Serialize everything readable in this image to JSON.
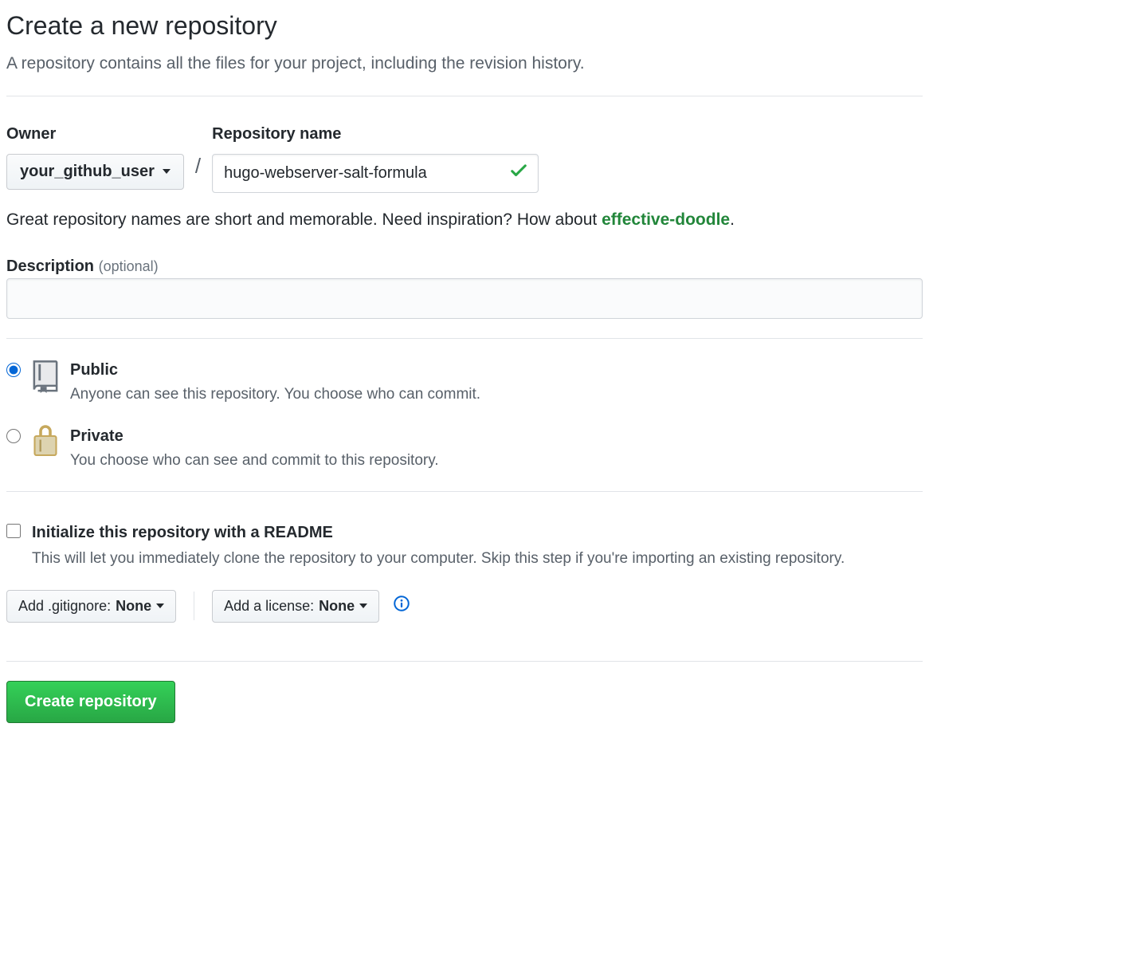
{
  "header": {
    "title": "Create a new repository",
    "subtitle": "A repository contains all the files for your project, including the revision history."
  },
  "owner": {
    "label": "Owner",
    "selected": "your_github_user"
  },
  "repo": {
    "label": "Repository name",
    "value": "hugo-webserver-salt-formula"
  },
  "hint": {
    "prefix": "Great repository names are short and memorable. Need inspiration? How about ",
    "suggestion": "effective-doodle",
    "suffix": "."
  },
  "description": {
    "label": "Description ",
    "optional": "(optional)",
    "value": ""
  },
  "visibility": {
    "public": {
      "label": "Public",
      "desc": "Anyone can see this repository. You choose who can commit."
    },
    "private": {
      "label": "Private",
      "desc": "You choose who can see and commit to this repository."
    }
  },
  "init": {
    "label": "Initialize this repository with a README",
    "desc": "This will let you immediately clone the repository to your computer. Skip this step if you're importing an existing repository."
  },
  "gitignore": {
    "prefix": "Add .gitignore: ",
    "value": "None"
  },
  "license": {
    "prefix": "Add a license: ",
    "value": "None"
  },
  "submit": {
    "label": "Create repository"
  }
}
